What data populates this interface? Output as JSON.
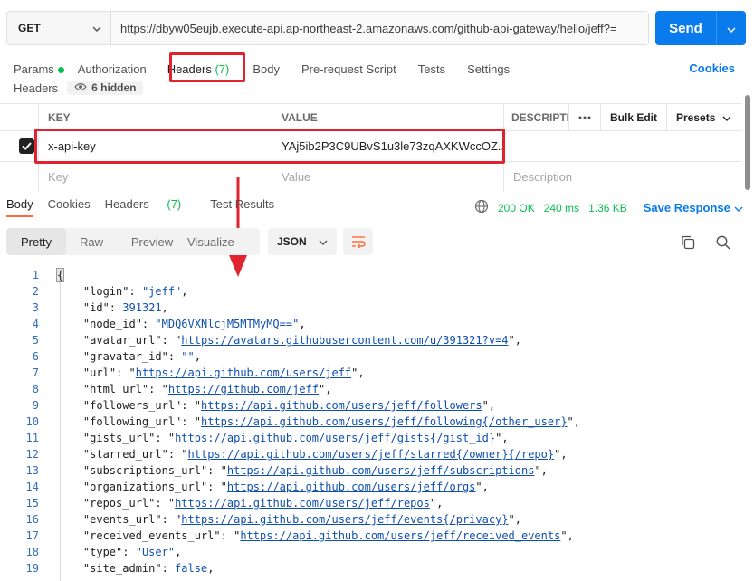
{
  "request": {
    "method": "GET",
    "url": "https://dbyw05eujb.execute-api.ap-northeast-2.amazonaws.com/github-api-gateway/hello/jeff?=",
    "send_label": "Send"
  },
  "request_tabs": {
    "params": "Params",
    "authorization": "Authorization",
    "headers": "Headers",
    "headers_count": "(7)",
    "body": "Body",
    "prerequest": "Pre-request Script",
    "tests": "Tests",
    "settings": "Settings",
    "cookies": "Cookies"
  },
  "headers_section": {
    "title": "Headers",
    "hidden": "6 hidden",
    "col_key": "KEY",
    "col_value": "VALUE",
    "col_desc": "DESCRIPTI",
    "bulk_edit": "Bulk Edit",
    "presets": "Presets",
    "rows": [
      {
        "key": "x-api-key",
        "value": "YAj5ib2P3C9UBvS1u3le73zqAXKWccOZ...",
        "checked": true
      }
    ],
    "placeholder_key": "Key",
    "placeholder_value": "Value",
    "placeholder_desc": "Description"
  },
  "response_tabs": {
    "body": "Body",
    "cookies": "Cookies",
    "headers": "Headers",
    "headers_count": "(7)",
    "test_results": "Test Results",
    "status": "200 OK",
    "time": "240 ms",
    "size": "1.36 KB",
    "save": "Save Response"
  },
  "view_toolbar": {
    "pretty": "Pretty",
    "raw": "Raw",
    "preview": "Preview",
    "visualize": "Visualize",
    "format": "JSON"
  },
  "code_lines": [
    {
      "n": "1",
      "k": "",
      "v": "{",
      "type": "open"
    },
    {
      "n": "2",
      "k": "login",
      "v": "\"jeff\"",
      "type": "s"
    },
    {
      "n": "3",
      "k": "id",
      "v": "391321",
      "type": "n"
    },
    {
      "n": "4",
      "k": "node_id",
      "v": "\"MDQ6VXNlcjM5MTMyMQ==\"",
      "type": "s"
    },
    {
      "n": "5",
      "k": "avatar_url",
      "v": "https://avatars.githubusercontent.com/u/391321?v=4",
      "type": "u"
    },
    {
      "n": "6",
      "k": "gravatar_id",
      "v": "\"\"",
      "type": "s"
    },
    {
      "n": "7",
      "k": "url",
      "v": "https://api.github.com/users/jeff",
      "type": "u"
    },
    {
      "n": "8",
      "k": "html_url",
      "v": "https://github.com/jeff",
      "type": "u"
    },
    {
      "n": "9",
      "k": "followers_url",
      "v": "https://api.github.com/users/jeff/followers",
      "type": "u"
    },
    {
      "n": "10",
      "k": "following_url",
      "v": "https://api.github.com/users/jeff/following{/other_user}",
      "type": "u"
    },
    {
      "n": "11",
      "k": "gists_url",
      "v": "https://api.github.com/users/jeff/gists{/gist_id}",
      "type": "u"
    },
    {
      "n": "12",
      "k": "starred_url",
      "v": "https://api.github.com/users/jeff/starred{/owner}{/repo}",
      "type": "u"
    },
    {
      "n": "13",
      "k": "subscriptions_url",
      "v": "https://api.github.com/users/jeff/subscriptions",
      "type": "u"
    },
    {
      "n": "14",
      "k": "organizations_url",
      "v": "https://api.github.com/users/jeff/orgs",
      "type": "u"
    },
    {
      "n": "15",
      "k": "repos_url",
      "v": "https://api.github.com/users/jeff/repos",
      "type": "u"
    },
    {
      "n": "16",
      "k": "events_url",
      "v": "https://api.github.com/users/jeff/events{/privacy}",
      "type": "u"
    },
    {
      "n": "17",
      "k": "received_events_url",
      "v": "https://api.github.com/users/jeff/received_events",
      "type": "u"
    },
    {
      "n": "18",
      "k": "type",
      "v": "\"User\"",
      "type": "s"
    },
    {
      "n": "19",
      "k": "site_admin",
      "v": "false",
      "type": "b"
    }
  ],
  "colors": {
    "accent": "#097bed",
    "success": "#0cbb52",
    "highlight": "#e0232e",
    "tab_active": "#ff6c37"
  },
  "icons": [
    "chevron-down-icon",
    "eye-icon",
    "checkbox-icon",
    "more-icon",
    "globe-icon",
    "wrap-icon",
    "copy-icon",
    "search-icon",
    "arrow-down-icon"
  ]
}
